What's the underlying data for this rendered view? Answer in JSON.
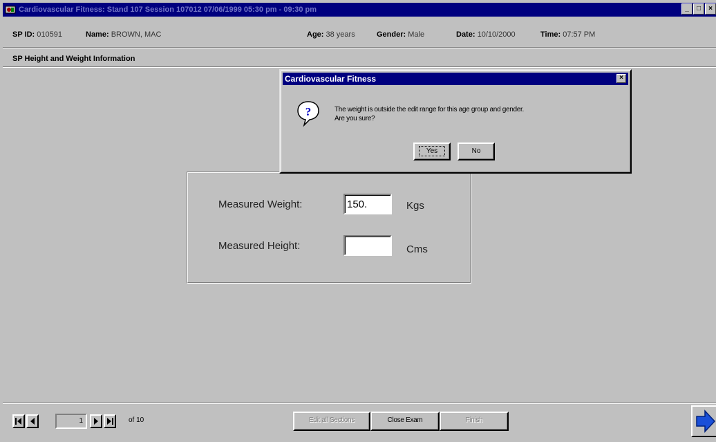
{
  "window": {
    "title": "Cardiovascular Fitness: Stand 107 Session 107012 07/06/1999 05:30 pm - 09:30 pm",
    "minimize": "_",
    "maximize": "□",
    "close": "×"
  },
  "header": {
    "sp_id_label": "SP ID:",
    "sp_id_value": "010591",
    "name_label": "Name:",
    "name_value": "BROWN, MAC",
    "age_label": "Age:",
    "age_value": "38 years",
    "gender_label": "Gender:",
    "gender_value": "Male",
    "date_label": "Date:",
    "date_value": "10/10/2000",
    "time_label": "Time:",
    "time_value": "07:57 PM"
  },
  "section": {
    "title": "SP Height and Weight Information"
  },
  "form": {
    "weight_label": "Measured Weight:",
    "weight_value": "150.",
    "weight_unit": "Kgs",
    "height_label": "Measured Height:",
    "height_value": "",
    "height_unit": "Cms"
  },
  "dialog": {
    "title": "Cardiovascular Fitness",
    "close": "×",
    "message_line1": "The weight is outside the edit range for this age group and gender.",
    "message_line2": "Are you sure?",
    "yes_label": "Yes",
    "no_label": "No"
  },
  "footer": {
    "page_current": "1",
    "page_of": "of 10",
    "edit_button": "Edit all Sections",
    "close_exam_button": "Close Exam",
    "finish_button": "Finish"
  },
  "colors": {
    "titlebar": "#00007f",
    "face": "#c0c0c0",
    "go_arrow": "#1a4fd8"
  }
}
